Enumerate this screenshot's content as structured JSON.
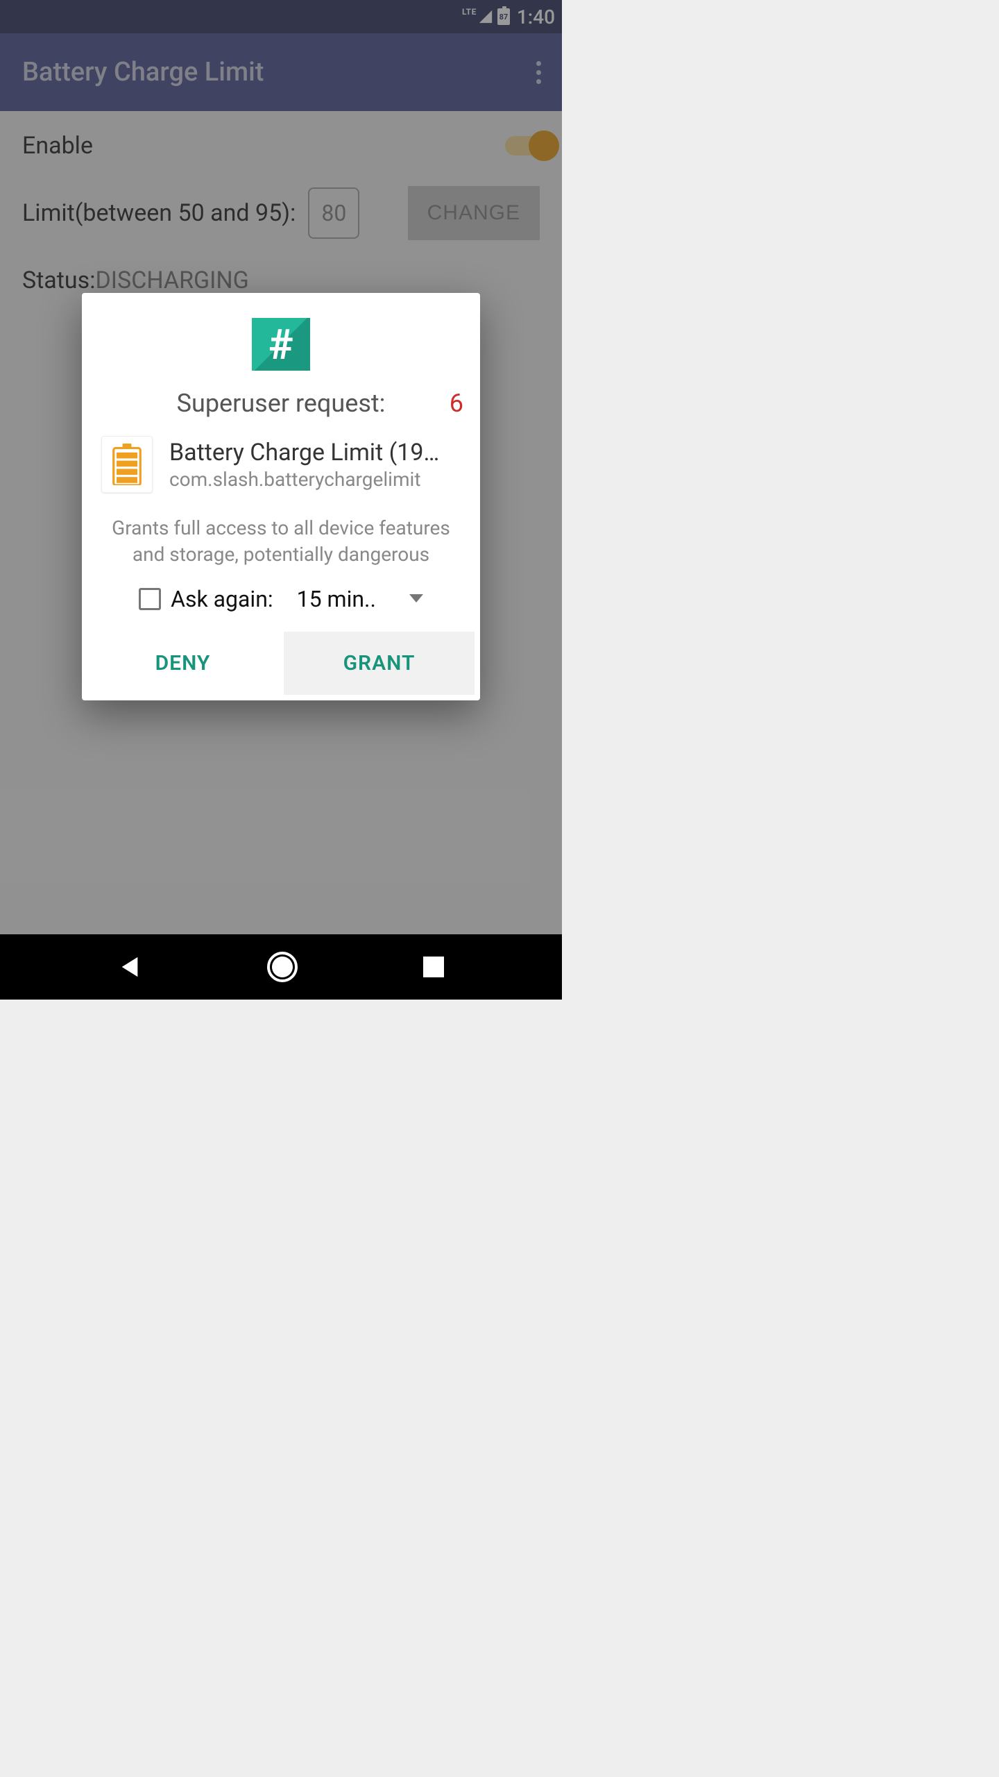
{
  "status_bar": {
    "network_label": "LTE",
    "battery_pct": "87",
    "clock": "1:40"
  },
  "app_bar": {
    "title": "Battery Charge Limit"
  },
  "main": {
    "enable_label": "Enable",
    "enable_on": true,
    "limit_label": "Limit(between 50 and 95):",
    "limit_value": "80",
    "change_label": "CHANGE",
    "status_label": "Status: ",
    "status_value": "DISCHARGING"
  },
  "dialog": {
    "title": "Superuser request:",
    "countdown": "6",
    "app_name": "Battery Charge Limit (19…",
    "app_package": "com.slash.batterychargelimit",
    "warning": "Grants full access to all device features and storage, potentially dangerous",
    "ask_again_label": "Ask again:",
    "ask_again_value": "15 min..",
    "deny_label": "DENY",
    "grant_label": "GRANT"
  }
}
